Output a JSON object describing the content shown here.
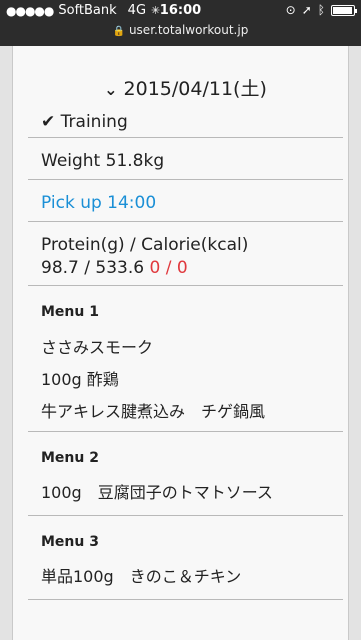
{
  "status": {
    "carrier": "SoftBank",
    "network": "4G",
    "time": "16:00",
    "url": "user.totalworkout.jp"
  },
  "log": {
    "date": "2015/04/11(土)",
    "training": "Training",
    "weight": "Weight 51.8kg",
    "pickup": "Pick up 14:00",
    "nutrition_label": "Protein(g) / Calorie(kcal)",
    "nutrition_values": "98.7 / 533.6",
    "nutrition_extra": "0 / 0"
  },
  "menus": [
    {
      "title": "Menu 1",
      "items": [
        "ささみスモーク",
        "100g 酢鶏",
        "牛アキレス腱煮込み　チゲ鍋風"
      ]
    },
    {
      "title": "Menu 2",
      "items": [
        "100g　豆腐団子のトマトソース"
      ]
    },
    {
      "title": "Menu 3",
      "items": [
        "単品100g　きのこ＆チキン"
      ]
    }
  ],
  "colors": {
    "link": "#1a8fd6",
    "alert": "#e0393e",
    "statusbar": "#2c2c2c"
  }
}
